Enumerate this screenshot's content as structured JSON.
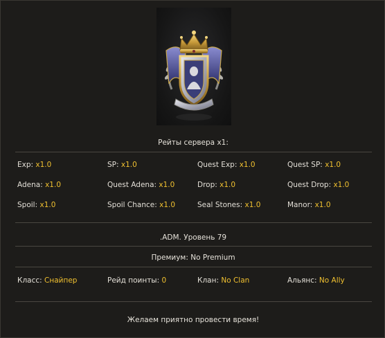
{
  "rates": {
    "title": "Рейты сервера x1:",
    "items": [
      {
        "label": "Exp:",
        "value": "x1.0"
      },
      {
        "label": "SP:",
        "value": "x1.0"
      },
      {
        "label": "Quest Exp:",
        "value": "x1.0"
      },
      {
        "label": "Quest SP:",
        "value": "x1.0"
      },
      {
        "label": "Adena:",
        "value": "x1.0"
      },
      {
        "label": "Quest Adena:",
        "value": "x1.0"
      },
      {
        "label": "Drop:",
        "value": "x1.0"
      },
      {
        "label": "Quest Drop:",
        "value": "x1.0"
      },
      {
        "label": "Spoil:",
        "value": "x1.0"
      },
      {
        "label": "Spoil Chance:",
        "value": "x1.0"
      },
      {
        "label": "Seal Stones:",
        "value": "x1.0"
      },
      {
        "label": "Manor:",
        "value": "x1.0"
      }
    ]
  },
  "character": {
    "name_level": ".ADM. Уровень 79",
    "premium": "Премиум: No Premium",
    "info": [
      {
        "label": "Класс:",
        "value": "Снайпер"
      },
      {
        "label": "Рейд поинты:",
        "value": "0"
      },
      {
        "label": "Клан:",
        "value": "No Clan"
      },
      {
        "label": "Альянс:",
        "value": "No Ally"
      }
    ]
  },
  "farewell": "Желаем приятно провести время!",
  "colors": {
    "background": "#1d1c1a",
    "value_accent": "#f0c030",
    "divider": "#4a4741"
  },
  "emblem": {
    "icon": "crest-emblem-icon"
  }
}
